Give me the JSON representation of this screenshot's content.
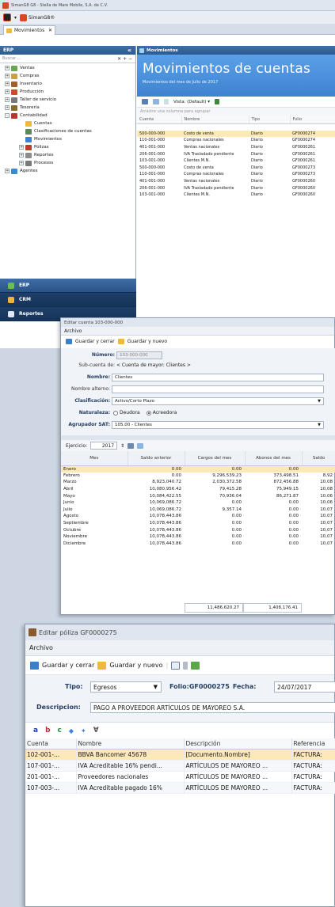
{
  "win1": {
    "title": "SimanG8 G8 - Stella de Mare Mobile, S.A. de C.V.",
    "app_name": "SimanG8®",
    "tab": "Movimientos",
    "left": {
      "header": "ERP",
      "search_placeholder": "Buscar ...",
      "tree": [
        {
          "label": "Ventas",
          "level": 0,
          "exp": "+"
        },
        {
          "label": "Compras",
          "level": 0,
          "exp": "+"
        },
        {
          "label": "Inventario",
          "level": 0,
          "exp": "+"
        },
        {
          "label": "Producción",
          "level": 0,
          "exp": "+"
        },
        {
          "label": "Taller de servicio",
          "level": 0,
          "exp": "+"
        },
        {
          "label": "Tesorería",
          "level": 0,
          "exp": "+"
        },
        {
          "label": "Contabilidad",
          "level": 0,
          "exp": "-"
        },
        {
          "label": "Cuentas",
          "level": 1,
          "exp": ""
        },
        {
          "label": "Clasificaciones de cuentas",
          "level": 1,
          "exp": ""
        },
        {
          "label": "Movimientos",
          "level": 1,
          "exp": ""
        },
        {
          "label": "Pólizas",
          "level": 1,
          "exp": "+"
        },
        {
          "label": "Reportes",
          "level": 1,
          "exp": "+"
        },
        {
          "label": "Procesos",
          "level": 1,
          "exp": "+"
        },
        {
          "label": "Agentes",
          "level": 0,
          "exp": "+"
        }
      ],
      "nav": [
        "ERP",
        "CRM",
        "Reportes"
      ]
    },
    "right": {
      "header": "Movimientos",
      "banner_title": "Movimientos de cuentas",
      "banner_subtitle": "Movimientos del mes de Julio de 2017",
      "view_label": "Vista: (Default) ▾",
      "group_hint": "Arrastre una columna para agrupar",
      "columns": [
        "Cuenta",
        "Nombre",
        "Tipo",
        "Folio"
      ],
      "rows": [
        [
          "",
          "",
          "",
          ""
        ],
        [
          "500-000-000",
          "Costo de venta",
          "Diario",
          "GF0000274"
        ],
        [
          "110-001-000",
          "Compras nacionales",
          "Diario",
          "GF0000274"
        ],
        [
          "401-001-000",
          "Ventas nacionales",
          "Diario",
          "GF0000261"
        ],
        [
          "206-001-000",
          "IVA Trasladado pendiente",
          "Diario",
          "GF0000261"
        ],
        [
          "103-001-000",
          "Clientes M.N.",
          "Diario",
          "GF0000261"
        ],
        [
          "500-000-000",
          "Costo de venta",
          "Diario",
          "GF0000273"
        ],
        [
          "110-001-000",
          "Compras nacionales",
          "Diario",
          "GF0000273"
        ],
        [
          "401-001-000",
          "Ventas nacionales",
          "Diario",
          "GF0000260"
        ],
        [
          "206-001-000",
          "IVA Trasladado pendiente",
          "Diario",
          "GF0000260"
        ],
        [
          "103-001-000",
          "Clientes M.N.",
          "Diario",
          "GF0000260"
        ]
      ]
    }
  },
  "win2": {
    "title": "Editar cuenta 103-000-000",
    "menu": "Archivo",
    "save_close": "Guardar y cerrar",
    "save_new": "Guardar y nuevo",
    "numero_label": "Número:",
    "numero_value": "103-000-000",
    "subcuenta_label": "Sub-cuenta de:",
    "subcuenta_value": "< Cuenta de mayor: Clientes >",
    "nombre_label": "Nombre:",
    "nombre_value": "Clientes",
    "alterno_label": "Nombre alterno:",
    "alterno_value": "",
    "clasif_label": "Clasificación:",
    "clasif_value": "Activo/Corto Plazo",
    "naturaleza_label": "Naturaleza:",
    "deudora": "Deudora",
    "acreedora": "Acreedora",
    "sat_label": "Agrupador SAT:",
    "sat_value": "105.00 - Clientes",
    "ejercicio_label": "Ejercicio:",
    "ejercicio_value": "2017",
    "columns": [
      "Mes",
      "Saldo anterior",
      "Cargos del mes",
      "Abonos del mes",
      "Saldo"
    ],
    "rows": [
      [
        "Enero",
        "0.00",
        "0.00",
        "0.00",
        ""
      ],
      [
        "Febrero",
        "0.00",
        "9,296,539.23",
        "373,498.51",
        "8,92"
      ],
      [
        "Marzo",
        "8,923,040.72",
        "2,030,372.58",
        "872,456.88",
        "10,08"
      ],
      [
        "Abril",
        "10,080,956.42",
        "79,415.28",
        "75,949.15",
        "10,08"
      ],
      [
        "Mayo",
        "10,084,422.55",
        "70,936.04",
        "86,271.87",
        "10,06"
      ],
      [
        "Junio",
        "10,069,086.72",
        "0.00",
        "0.00",
        "10,06"
      ],
      [
        "Julio",
        "10,069,086.72",
        "9,357.14",
        "0.00",
        "10,07"
      ],
      [
        "Agosto",
        "10,078,443.86",
        "0.00",
        "0.00",
        "10,07"
      ],
      [
        "Septiembre",
        "10,078,443.86",
        "0.00",
        "0.00",
        "10,07"
      ],
      [
        "Octubre",
        "10,078,443.86",
        "0.00",
        "0.00",
        "10,07"
      ],
      [
        "Noviembre",
        "10,078,443.86",
        "0.00",
        "0.00",
        "10,07"
      ],
      [
        "Diciembre",
        "10,078,443.86",
        "0.00",
        "0.00",
        "10,07"
      ]
    ],
    "total_cargos": "11,486,620.27",
    "total_abonos": "1,408,176.41"
  },
  "win3": {
    "title": "Editar póliza GF0000275",
    "menu": "Archivo",
    "save_close": "Guardar y cerrar",
    "save_new": "Guardar y nuevo",
    "tipo_label": "Tipo:",
    "tipo_value": "Egresos",
    "folio_label": "Folio:GF0000275",
    "fecha_label": "Fecha:",
    "fecha_value": "24/07/2017",
    "desc_label": "Descripcion:",
    "desc_value": "PAGO A PROVEEDOR ARTÍCULOS DE MAYOREO S.A.",
    "columns": [
      "Cuenta",
      "Nombre",
      "Descripción",
      "Referencia"
    ],
    "rows": [
      [
        "102-001-...",
        "BBVA Bancomer 45678",
        "[Documento.Nombre]",
        "FACTURA:"
      ],
      [
        "107-001-...",
        "IVA Acreditable 16% pendi...",
        "ARTÍCULOS DE MAYOREO ...",
        "FACTURA:"
      ],
      [
        "201-001-...",
        "Proveedores nacionales",
        "ARTÍCULOS DE MAYOREO ...",
        "FACTURA:"
      ],
      [
        "107-003-...",
        "IVA Acreditable pagado 16%",
        "ARTÍCULOS DE MAYOREO ...",
        "FACTURA:"
      ]
    ]
  },
  "colors": {
    "accent": "#2c5a92",
    "banner": "#4a90dc",
    "selected_row": "#fde8b8"
  }
}
